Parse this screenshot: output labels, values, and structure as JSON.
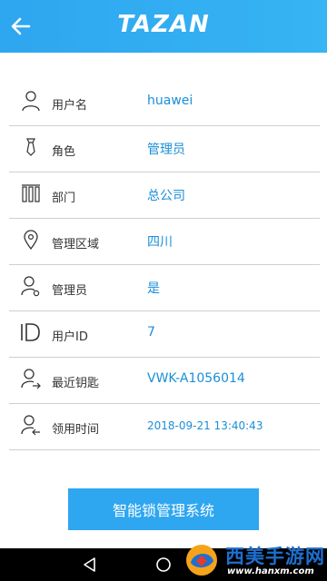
{
  "header": {
    "logo_text": "TAZAN",
    "back_icon": "arrow-left-icon"
  },
  "rows": [
    {
      "icon": "user-icon",
      "label": "用户名",
      "value": "huawei"
    },
    {
      "icon": "tie-icon",
      "label": "角色",
      "value": "管理员"
    },
    {
      "icon": "building-icon",
      "label": "部门",
      "value": "总公司"
    },
    {
      "icon": "location-pin-icon",
      "label": "管理区域",
      "value": "四川"
    },
    {
      "icon": "admin-user-icon",
      "label": "管理员",
      "value": "是"
    },
    {
      "icon": "id-icon",
      "label": "用户ID",
      "value": "7"
    },
    {
      "icon": "user-key-icon",
      "label": "最近钥匙",
      "value": "VWK-A1056014"
    },
    {
      "icon": "user-time-icon",
      "label": "领用时间",
      "value": "2018-09-21 13:40:43"
    }
  ],
  "primary_button": {
    "label": "智能锁管理系统"
  },
  "watermark": {
    "title": "西美手游网",
    "url": "www.hanxm.com"
  },
  "colors": {
    "header": "#2ea6f0",
    "accent_text": "#1a8fd8",
    "button": "#2ea6f0"
  }
}
